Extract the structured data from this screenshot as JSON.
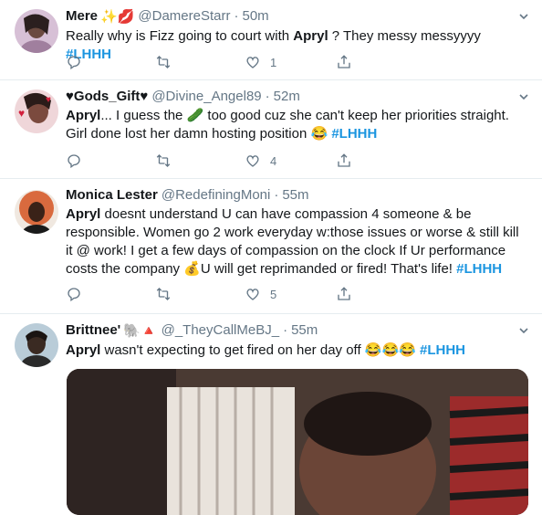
{
  "tweets": [
    {
      "name": "Mere",
      "name_emoji": "✨💋",
      "handle": "@DamereStarr",
      "time": "50m",
      "text_parts": [
        "Really why is Fizz going to court with ",
        "Apryl",
        " ? They messy messyyyy ",
        "#LHHH"
      ],
      "likes": "1",
      "avatar_colors": [
        "#c9a3c7",
        "#5b3a4a"
      ]
    },
    {
      "name": "♥Gods_Gift♥",
      "handle": "@Divine_Angel89",
      "time": "52m",
      "text_parts": [
        "Apryl",
        "... I guess the ",
        "🥒",
        " too good cuz she can't keep her priorities straight. Girl done lost her damn hosting position ",
        "😂",
        " ",
        "#LHHH"
      ],
      "likes": "4",
      "avatar_colors": [
        "#e7c2c7",
        "#7b4a3e"
      ]
    },
    {
      "name": "Monica Lester",
      "handle": "@RedefiningMoni",
      "time": "55m",
      "text_parts": [
        "Apryl",
        " doesnt understand U can have compassion 4 someone & be responsible. Women go 2 work everyday w:those issues or worse & still kill it @ work! I get a few days of compassion on the clock If Ur performance costs the company ",
        "💰",
        "U will get reprimanded or fired! That's life! ",
        "#LHHH"
      ],
      "likes": "5",
      "avatar_colors": [
        "#d98a6b",
        "#2b1a14"
      ]
    },
    {
      "name": "Brittnee'",
      "name_emoji": "🐘🔺",
      "handle": "@_TheyCallMeBJ_",
      "time": "55m",
      "text_parts": [
        "Apryl",
        " wasn't expecting to get fired on her day off ",
        "😂😂😂",
        " ",
        "#LHHH"
      ],
      "avatar_colors": [
        "#9fb5c4",
        "#2a2220"
      ]
    }
  ],
  "icons": {
    "reply": "reply-icon",
    "retweet": "retweet-icon",
    "like": "heart-icon",
    "share": "share-icon",
    "caret": "chevron-down-icon"
  },
  "colors": {
    "hashtag": "#1b95e0",
    "muted": "#657786",
    "divider": "#e6ecf0"
  }
}
